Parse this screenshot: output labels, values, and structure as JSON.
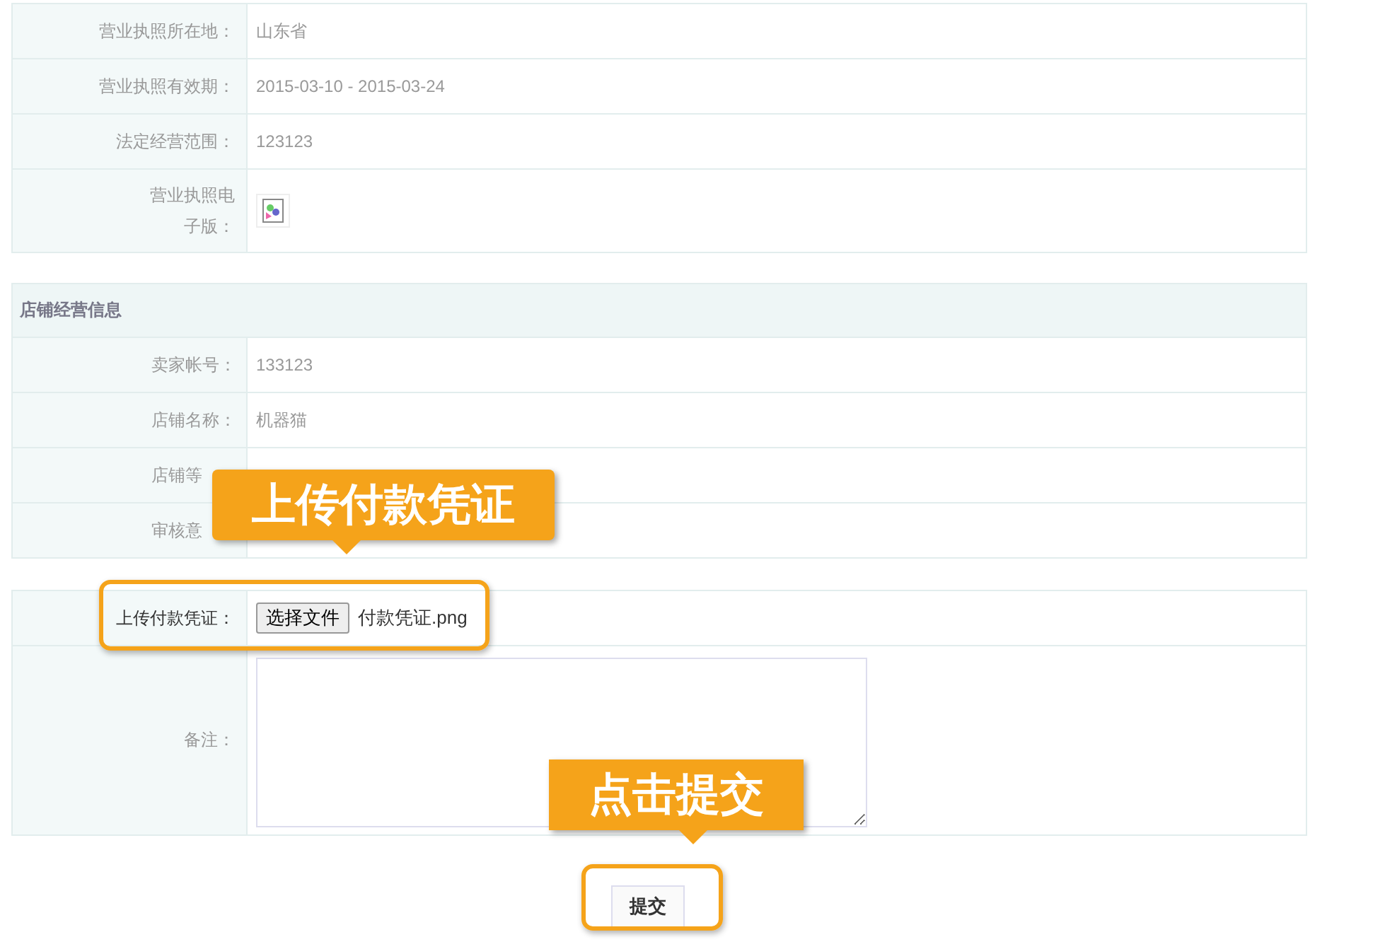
{
  "license_rows": [
    {
      "kind": "text",
      "label": "营业执照所在地：",
      "value": "山东省"
    },
    {
      "kind": "text",
      "label": "营业执照有效期：",
      "value": "2015-03-10 - 2015-03-24"
    },
    {
      "kind": "text",
      "label": "法定经营范围：",
      "value": "123123"
    },
    {
      "kind": "image",
      "label": "营业执照电子版："
    }
  ],
  "shop_section": {
    "title": "店铺经营信息",
    "rows": [
      {
        "label": "卖家帐号：",
        "value": "133123"
      },
      {
        "label": "店铺名称：",
        "value": "机器猫"
      },
      {
        "label": "店铺等"
      },
      {
        "label": "审核意"
      }
    ]
  },
  "upload": {
    "label": "上传付款凭证：",
    "button": "选择文件",
    "filename": "付款凭证.png"
  },
  "note": {
    "label": "备注："
  },
  "submit": "提交",
  "callouts": [
    {
      "text": "上传付款凭证"
    },
    {
      "text": "点击提交"
    }
  ]
}
